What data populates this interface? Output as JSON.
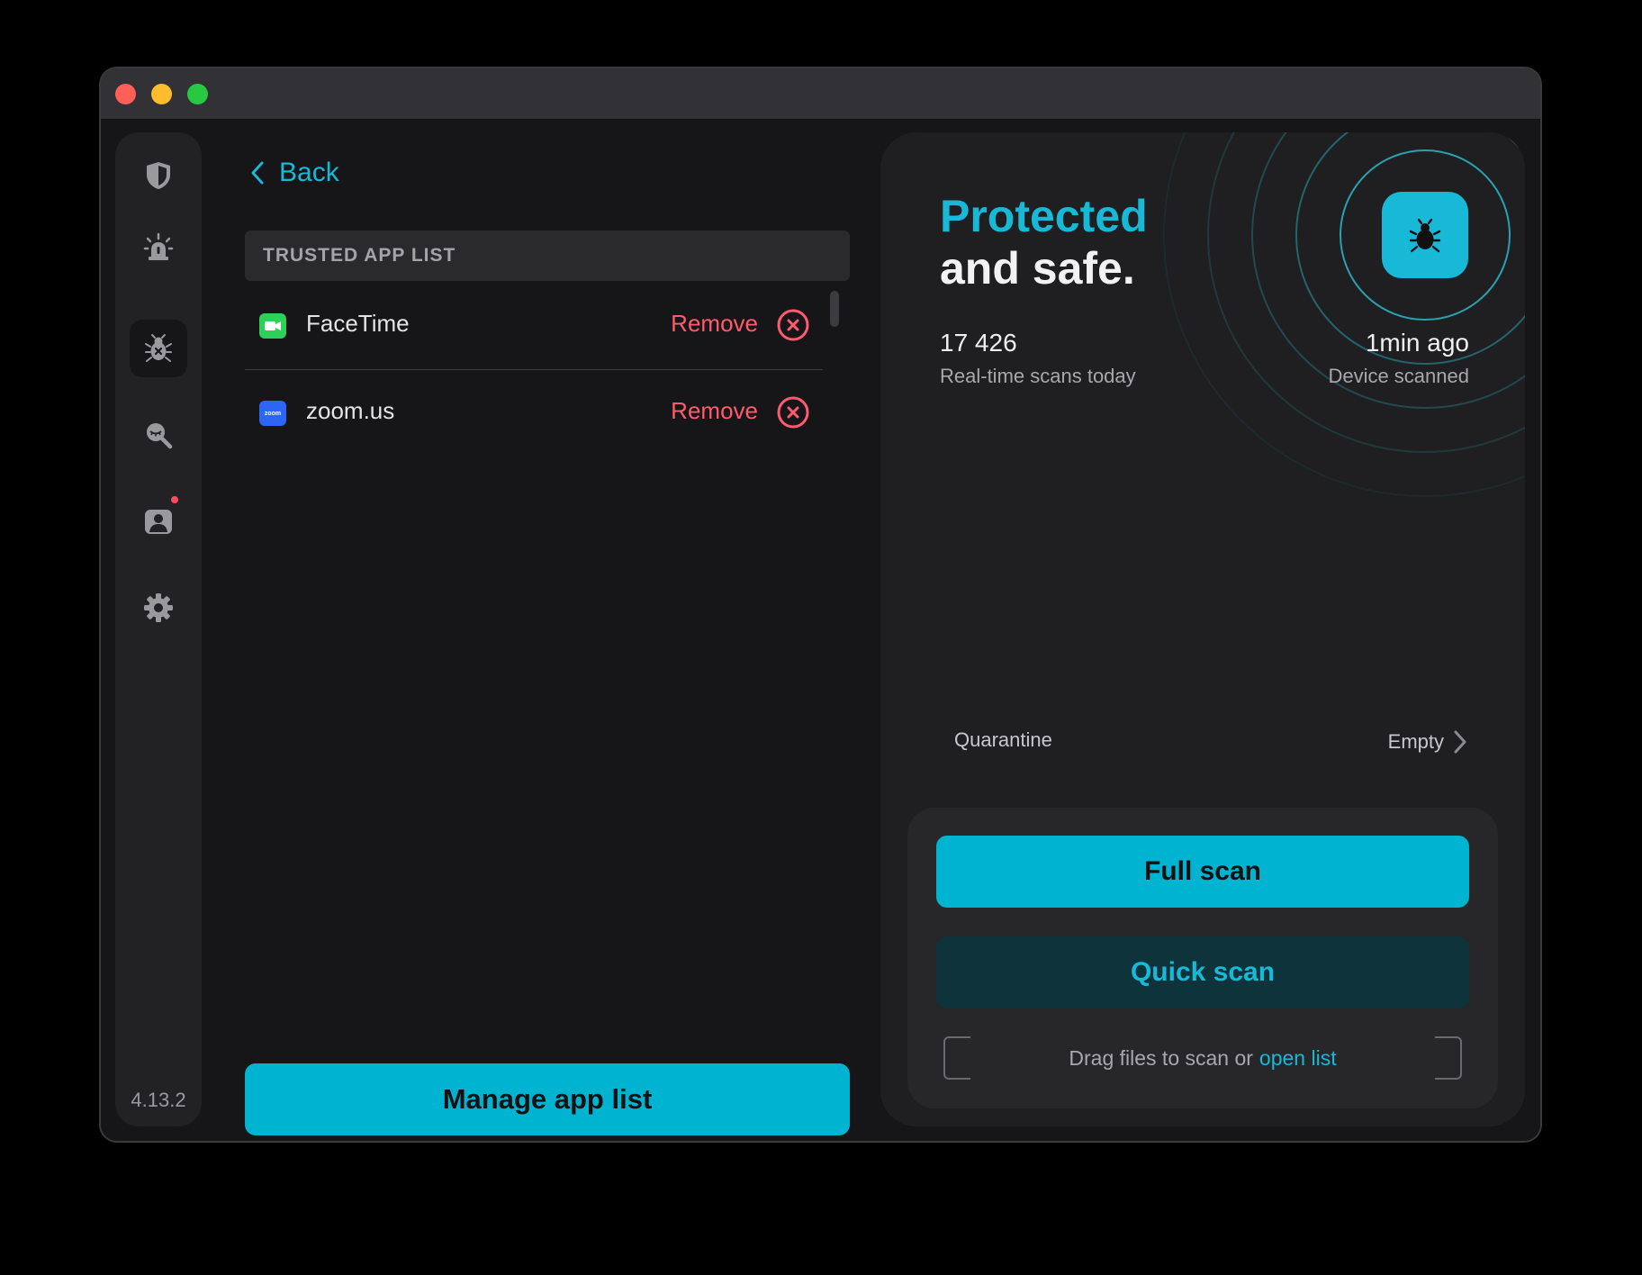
{
  "sidebar": {
    "items": [
      {
        "icon": "shield-icon",
        "active": false
      },
      {
        "icon": "alarm-icon",
        "active": false
      },
      {
        "icon": "bug-icon",
        "active": true
      },
      {
        "icon": "search-eye-icon",
        "active": false
      },
      {
        "icon": "user-icon",
        "active": false,
        "badge": true
      },
      {
        "icon": "gear-icon",
        "active": false
      }
    ],
    "version": "4.13.2"
  },
  "left_panel": {
    "back_label": "Back",
    "list_title": "TRUSTED APP LIST",
    "apps": [
      {
        "name": "FaceTime",
        "icon": "facetime-icon",
        "remove_label": "Remove"
      },
      {
        "name": "zoom.us",
        "icon": "zoom-icon",
        "icon_text": "zoom",
        "remove_label": "Remove"
      }
    ],
    "manage_button": "Manage app list"
  },
  "right_panel": {
    "status_highlight": "Protected",
    "status_rest": "and safe.",
    "scans_count": "17 426",
    "scans_label": "Real-time scans today",
    "last_scan": "1min ago",
    "last_scan_label": "Device scanned",
    "quarantine_label": "Quarantine",
    "quarantine_value": "Empty",
    "full_scan": "Full scan",
    "quick_scan": "Quick scan",
    "drag_text": "Drag files to scan or",
    "open_list": "open list"
  },
  "colors": {
    "accent": "#00b3d1",
    "danger": "#ff5a6e",
    "background": "#161618"
  }
}
